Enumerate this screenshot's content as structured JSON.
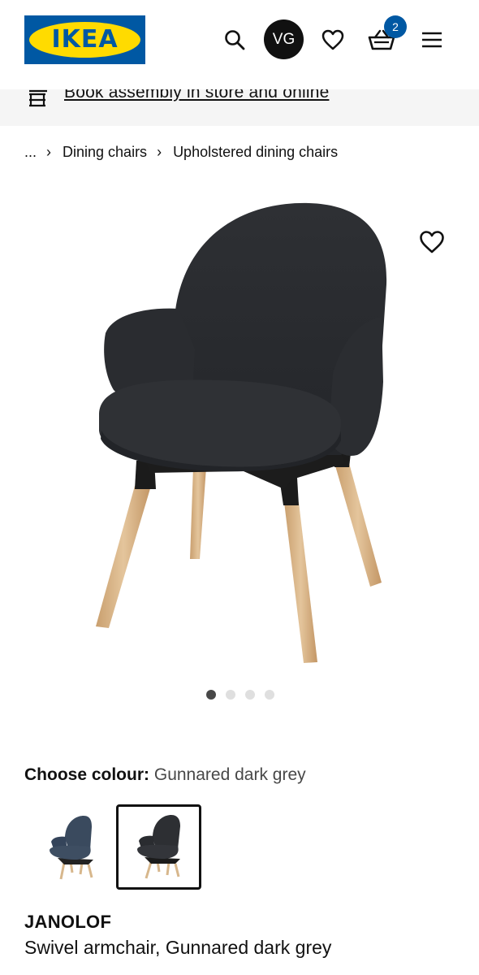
{
  "header": {
    "logo_text": "IKEA",
    "avatar_initials": "VG",
    "cart_count": "2",
    "icons": [
      "search-icon",
      "heart-icon",
      "basket-icon",
      "menu-icon"
    ],
    "brand_blue": "#0058a3",
    "brand_yellow": "#ffdb00"
  },
  "banner": {
    "link_text": "Book assembly in store and online",
    "icon": "assembly-icon"
  },
  "breadcrumb": {
    "items": [
      "...",
      "Dining chairs",
      "Upholstered dining chairs"
    ]
  },
  "gallery": {
    "image_count": 4,
    "active_index": 0
  },
  "colour": {
    "label": "Choose colour:",
    "value": "Gunnared dark grey",
    "swatches": [
      {
        "name": "blue",
        "color": "#3b4a5c",
        "selected": false
      },
      {
        "name": "Gunnared dark grey",
        "color": "#2d2f33",
        "selected": true
      }
    ]
  },
  "product": {
    "name": "JANOLOF",
    "description": "Swivel armchair, Gunnared dark grey"
  }
}
